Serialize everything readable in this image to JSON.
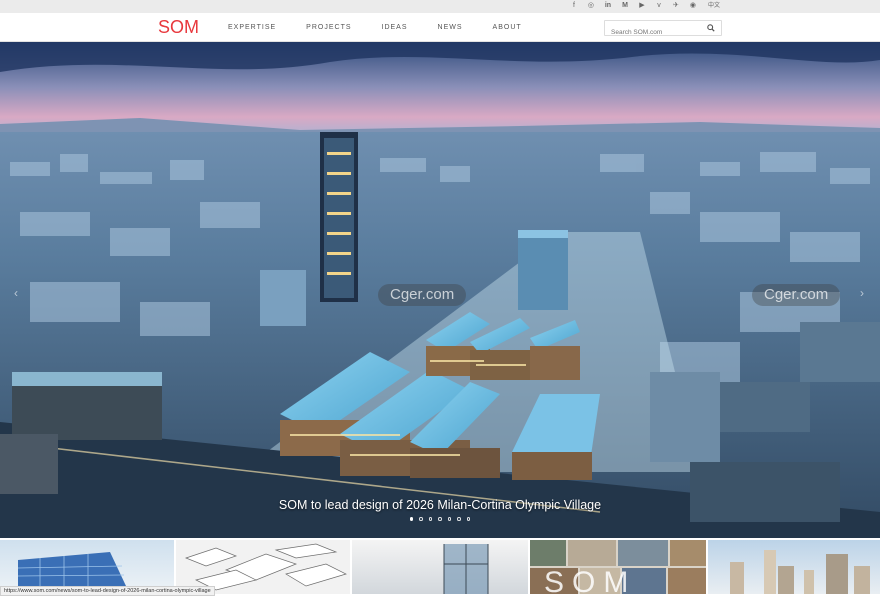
{
  "social": {
    "icons": [
      "facebook-icon",
      "instagram-icon",
      "linkedin-icon",
      "medium-icon",
      "youtube-icon",
      "vimeo-icon",
      "twitter-icon",
      "weibo-icon"
    ],
    "language": "中文"
  },
  "brand": {
    "logo_text": "SOM",
    "accent": "#e8383d"
  },
  "nav": {
    "items": [
      "EXPERTISE",
      "PROJECTS",
      "IDEAS",
      "NEWS",
      "ABOUT"
    ]
  },
  "search": {
    "placeholder": "Search SOM.com",
    "value": ""
  },
  "hero": {
    "caption": "SOM to lead design of 2026 Milan-Cortina Olympic Village",
    "slide_count": 7,
    "active_slide": 1,
    "watermark": "Cger.com"
  },
  "status_url": "https://www.som.com/news/som-to-lead-design-of-2026-milan-cortina-olympic-village"
}
